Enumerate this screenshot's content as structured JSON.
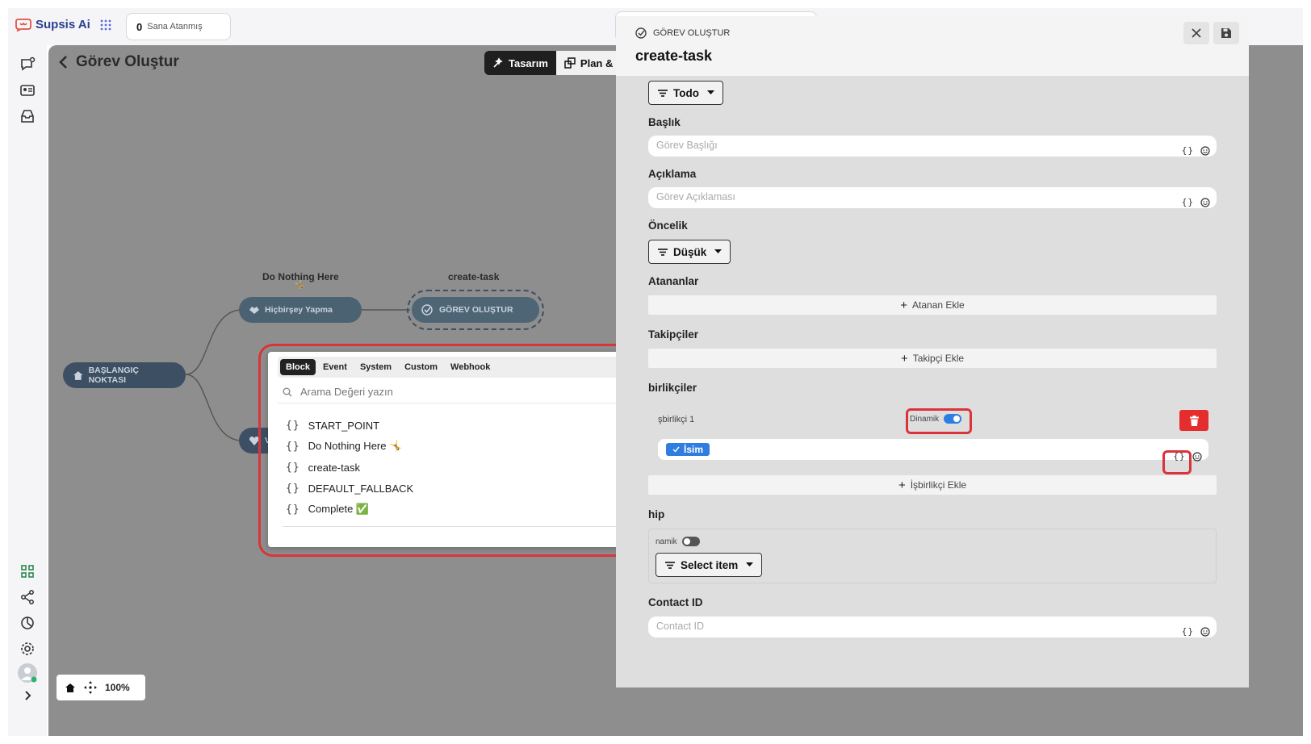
{
  "app": {
    "name": "Supsis Ai"
  },
  "topbar": {
    "assigned_count": "0",
    "assigned_label": "Sana Atanmış"
  },
  "canvas": {
    "title": "Görev Oluştur",
    "tabs": [
      {
        "label": "Tasarım"
      },
      {
        "label": "Plan & G"
      }
    ],
    "nodes": {
      "start": "BAŞLANGIÇ NOKTASI",
      "nothing_label": "Do Nothing Here",
      "nothing_node": "Hiçbirşey Yapma",
      "task_label": "create-task",
      "task_node": "GÖREV OLUŞTUR",
      "partial_node": "V"
    },
    "zoom": "100%"
  },
  "popup": {
    "tabs": [
      "Block",
      "Event",
      "System",
      "Custom",
      "Webhook"
    ],
    "active_tab": "Block",
    "search_placeholder": "Arama Değeri yazın",
    "items": [
      "START_POINT",
      "Do Nothing Here 🤸",
      "create-task",
      "DEFAULT_FALLBACK",
      "Complete ✅"
    ]
  },
  "panel": {
    "kicker": "GÖREV OLUŞTUR",
    "title": "create-task",
    "status_value": "Todo",
    "title_label": "Başlık",
    "title_placeholder": "Görev Başlığı",
    "desc_label": "Açıklama",
    "desc_placeholder": "Görev Açıklaması",
    "priority_label": "Öncelik",
    "priority_value": "Düşük",
    "assignees_label": "Atananlar",
    "assignees_add": "Atanan Ekle",
    "followers_label": "Takipçiler",
    "followers_add": "Takipçi Ekle",
    "collab_label": "birlikçiler",
    "collab_item": "şbirlikçi 1",
    "dynamic_label": "Dinamik",
    "collab_chip": "İsim",
    "collab_add": "İşbirlikçi Ekle",
    "owner_label": "hip",
    "owner_dynamic": "namik",
    "owner_select": "Select item",
    "contact_label": "Contact ID",
    "contact_placeholder": "Contact ID"
  },
  "colors": {
    "accent_red": "#d9343a",
    "toggle_blue": "#2f7de1",
    "node_fill": "#3d4f63"
  }
}
